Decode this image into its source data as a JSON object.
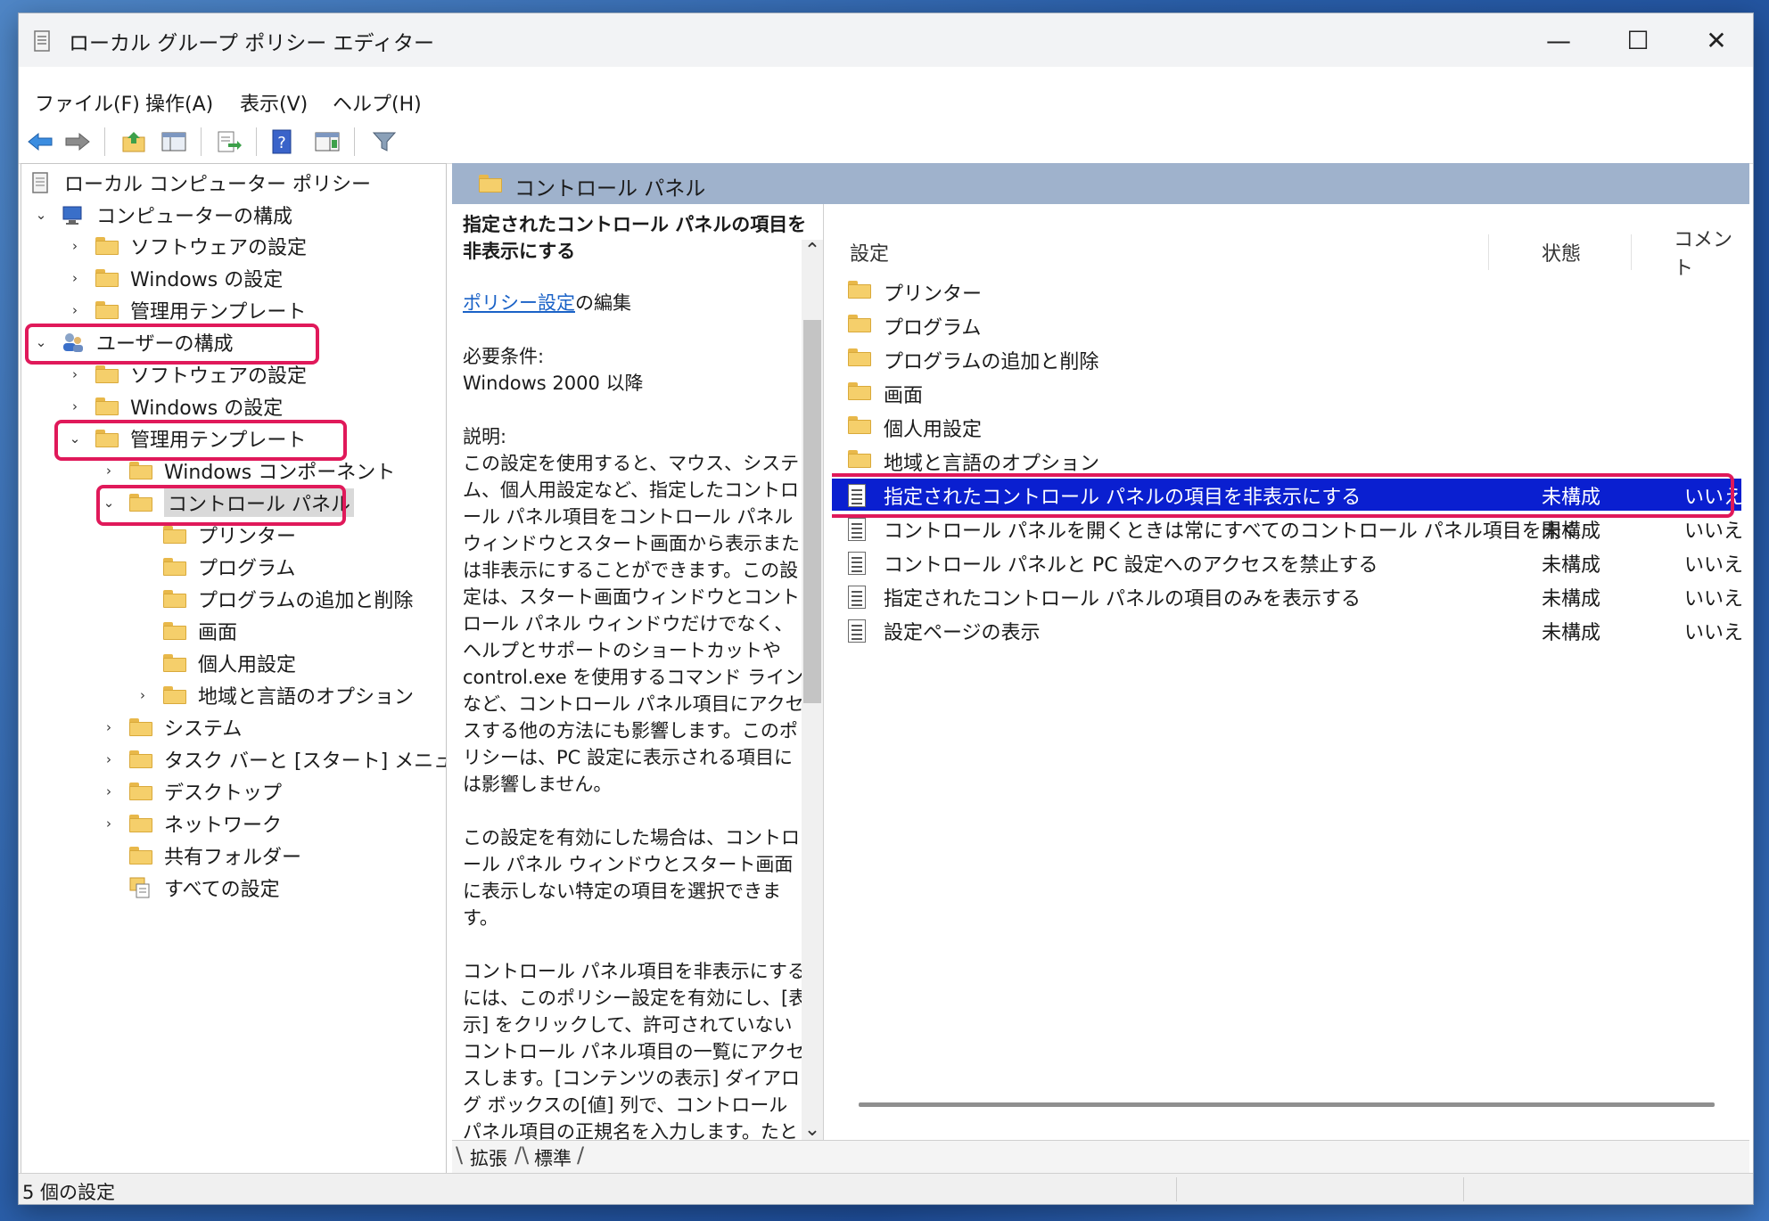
{
  "window": {
    "title": "ローカル グループ ポリシー エディター",
    "controls": {
      "minimize": "—",
      "maximize": "☐",
      "close": "✕"
    }
  },
  "menu": [
    {
      "label": "ファイル(F)"
    },
    {
      "label": "操作(A)"
    },
    {
      "label": "表示(V)"
    },
    {
      "label": "ヘルプ(H)"
    }
  ],
  "toolbar": [
    "back-icon",
    "forward-icon",
    "up-folder-icon",
    "show-hide-tree-icon",
    "export-list-icon",
    "help-icon",
    "properties-icon",
    "filter-icon"
  ],
  "tree": {
    "root": "ローカル コンピューター ポリシー",
    "items": [
      {
        "label": "コンピューターの構成"
      },
      {
        "label": "ソフトウェアの設定"
      },
      {
        "label": "Windows の設定"
      },
      {
        "label": "管理用テンプレート"
      },
      {
        "label": "ユーザーの構成"
      },
      {
        "label": "ソフトウェアの設定"
      },
      {
        "label": "Windows の設定"
      },
      {
        "label": "管理用テンプレート"
      },
      {
        "label": "Windows コンポーネント"
      },
      {
        "label": "コントロール パネル"
      },
      {
        "label": "プリンター"
      },
      {
        "label": "プログラム"
      },
      {
        "label": "プログラムの追加と削除"
      },
      {
        "label": "画面"
      },
      {
        "label": "個人用設定"
      },
      {
        "label": "地域と言語のオプション"
      },
      {
        "label": "システム"
      },
      {
        "label": "タスク バーと [スタート] メニュー"
      },
      {
        "label": "デスクトップ"
      },
      {
        "label": "ネットワーク"
      },
      {
        "label": "共有フォルダー"
      },
      {
        "label": "すべての設定"
      }
    ]
  },
  "header": {
    "title": "コントロール パネル"
  },
  "description": {
    "title": "指定されたコントロール パネルの項目を非表示にする",
    "edit_link": "ポリシー設定",
    "edit_suffix": "の編集",
    "requirements_label": "必要条件:",
    "requirements_value": "Windows 2000 以降",
    "explanation_label": "説明:",
    "p1": "この設定を使用すると、マウス、システム、個人用設定など、指定したコントロール パネル項目をコントロール パネル ウィンドウとスタート画面から表示または非表示にすることができます。この設定は、スタート画面ウィンドウとコントロール パネル ウィンドウだけでなく、ヘルプとサポートのショートカットや control.exe を使用するコマンド ラインなど、コントロール パネル項目にアクセスする他の方法にも影響します。このポリシーは、PC 設定に表示される項目には影響しません。",
    "p2": "この設定を有効にした場合は、コントロール パネル ウィンドウとスタート画面に表示しない特定の項目を選択できます。",
    "p3": "コントロール パネル項目を非表示にするには、このポリシー設定を有効にし、[表示] をクリックして、許可されていないコントロール パネル項目の一覧にアクセスします。[コンテンツの表示] ダイアログ ボックスの[値] 列で、コントロール パネル項目の正規名を入力します。たとえば、「Microsoft.Mouse」"
  },
  "list": {
    "columns": {
      "setting": "設定",
      "state": "状態",
      "comment": "コメント"
    },
    "folders": [
      "プリンター",
      "プログラム",
      "プログラムの追加と削除",
      "画面",
      "個人用設定",
      "地域と言語のオプション"
    ],
    "settings": [
      {
        "name": "指定されたコントロール パネルの項目を非表示にする",
        "state": "未構成",
        "comment": "いいえ"
      },
      {
        "name": "コントロール パネルを開くときは常にすべてのコントロール パネル項目を開く",
        "state": "未構成",
        "comment": "いいえ"
      },
      {
        "name": "コントロール パネルと PC 設定へのアクセスを禁止する",
        "state": "未構成",
        "comment": "いいえ"
      },
      {
        "name": "指定されたコントロール パネルの項目のみを表示する",
        "state": "未構成",
        "comment": "いいえ"
      },
      {
        "name": "設定ページの表示",
        "state": "未構成",
        "comment": "いいえ"
      }
    ]
  },
  "tabs": [
    {
      "label": "拡張"
    },
    {
      "label": "標準"
    }
  ],
  "status": {
    "text": "5 個の設定"
  },
  "colors": {
    "highlight": "#e0195a",
    "selection": "#0a1fd0",
    "header": "#9fb2cc",
    "link": "#1a62c7"
  }
}
